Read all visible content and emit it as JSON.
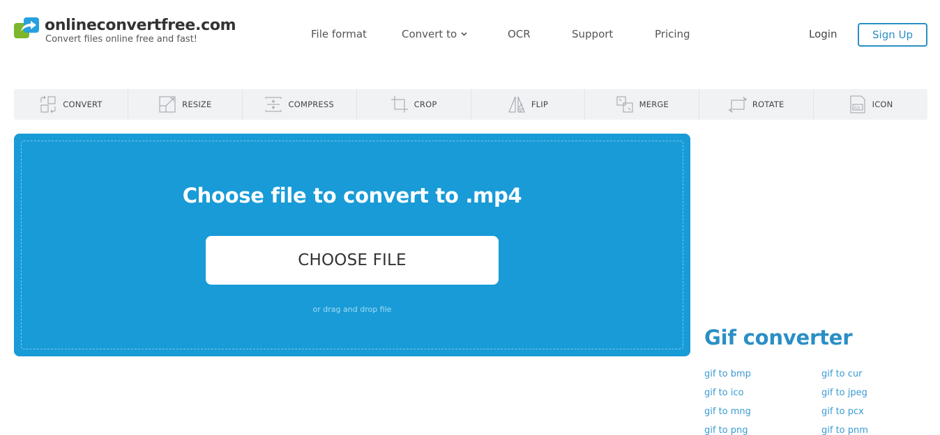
{
  "header": {
    "brand": "onlineconvertfree.com",
    "tagline": "Convert files online free and fast!",
    "nav": [
      {
        "label": "File format"
      },
      {
        "label": "Convert to",
        "has_dropdown": true
      },
      {
        "label": "OCR"
      },
      {
        "label": "Support"
      },
      {
        "label": "Pricing"
      }
    ],
    "login_label": "Login",
    "signup_label": "Sign Up"
  },
  "tools": [
    {
      "label": "CONVERT",
      "icon": "convert-icon"
    },
    {
      "label": "RESIZE",
      "icon": "resize-icon"
    },
    {
      "label": "COMPRESS",
      "icon": "compress-icon"
    },
    {
      "label": "CROP",
      "icon": "crop-icon"
    },
    {
      "label": "FLIP",
      "icon": "flip-icon"
    },
    {
      "label": "MERGE",
      "icon": "merge-icon"
    },
    {
      "label": "ROTATE",
      "icon": "rotate-icon"
    },
    {
      "label": "ICON",
      "icon": "ico-file-icon"
    }
  ],
  "upload": {
    "title": "Choose file to convert to .mp4",
    "button_label": "CHOOSE FILE",
    "drag_text": "or drag and drop file"
  },
  "sidebar": {
    "title": "Gif converter",
    "links": [
      "gif to bmp",
      "gif to cur",
      "gif to ico",
      "gif to jpeg",
      "gif to mng",
      "gif to pcx",
      "gif to png",
      "gif to pnm"
    ]
  },
  "colors": {
    "primary_blue": "#189bd7",
    "link_blue": "#2a8fc4",
    "logo_green": "#7cb72f",
    "toolbar_bg": "#f1f2f4"
  }
}
